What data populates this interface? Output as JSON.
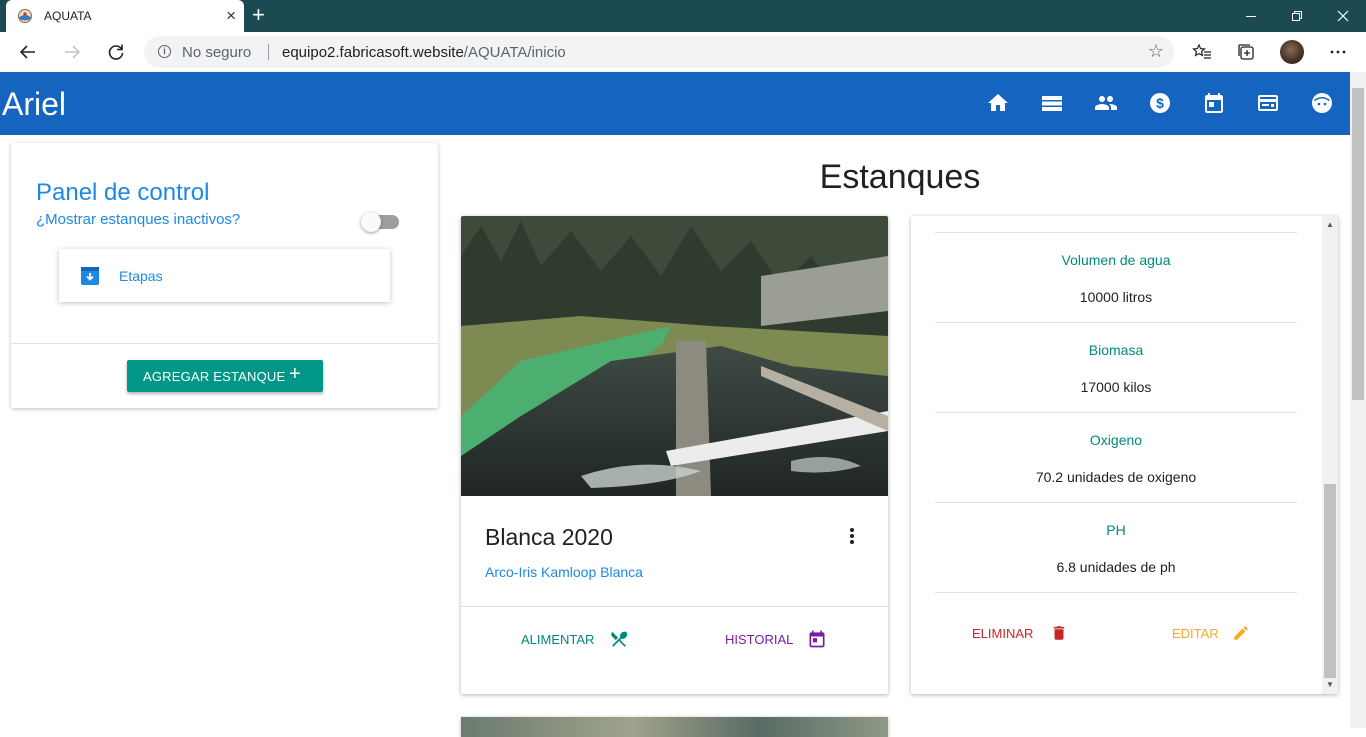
{
  "browser": {
    "tab_title": "AQUATA",
    "tab_close": "×",
    "new_tab": "+",
    "security_label": "No seguro",
    "url_domain": "equipo2.fabricasoft.website",
    "url_path": "/AQUATA/inicio",
    "window_controls": [
      "minimize-icon",
      "restore-icon",
      "close-icon"
    ],
    "toolbar_icons": [
      "back-icon",
      "forward-icon",
      "reload-icon",
      "star-icon",
      "favorites-icon",
      "collections-icon",
      "profile-avatar",
      "more-icon"
    ]
  },
  "app": {
    "brand": "Ariel",
    "nav_icons": [
      "home-icon",
      "list-icon",
      "people-icon",
      "dollar-icon",
      "calendar-icon",
      "card-icon",
      "face-icon"
    ],
    "primary_color": "#1565c0"
  },
  "panel": {
    "title": "Panel de control",
    "toggle_question": "¿Mostrar estanques inactivos?",
    "toggle_on": false,
    "etapas_label": "Etapas",
    "add_button": "AGREGAR ESTANQUE",
    "add_icon": "+"
  },
  "main": {
    "title": "Estanques"
  },
  "pond_card": {
    "name": "Blanca 2020",
    "species": "Arco-Iris Kamloop Blanca",
    "feed_label": "ALIMENTAR",
    "history_label": "HISTORIAL",
    "colors": {
      "feed": "#00897b",
      "history": "#7b1fa2"
    }
  },
  "pond_detail": {
    "fields": [
      {
        "label": "Volumen de agua",
        "value": "10000 litros"
      },
      {
        "label": "Biomasa",
        "value": "17000 kilos"
      },
      {
        "label": "Oxigeno",
        "value": "70.2 unidades de oxigeno"
      },
      {
        "label": "PH",
        "value": "6.8 unidades de ph"
      }
    ],
    "delete_label": "ELIMINAR",
    "edit_label": "EDITAR",
    "colors": {
      "label": "#00897b",
      "delete": "#c62828",
      "edit": "#f9a825"
    }
  }
}
